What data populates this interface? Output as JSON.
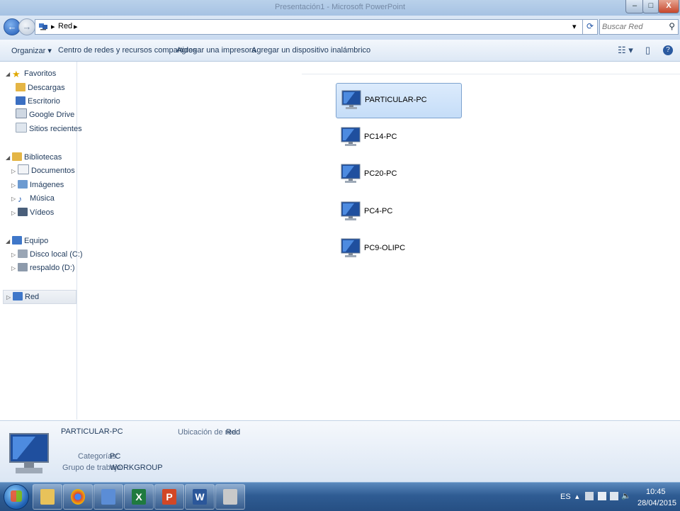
{
  "window": {
    "title": "Presentación1 - Microsoft PowerPoint",
    "buttons": {
      "minimize": "–",
      "maximize": "□",
      "close": "X"
    }
  },
  "address": {
    "breadcrumb": [
      "Red"
    ],
    "search_placeholder": "Buscar Red"
  },
  "toolbar": {
    "organize": "Organizar",
    "network_center": "Centro de redes y recursos compartidos",
    "add_printer": "Agregar una impresora",
    "add_wireless": "Agregar un dispositivo inalámbrico"
  },
  "nav": {
    "favorites": {
      "label": "Favoritos",
      "items": [
        "Descargas",
        "Escritorio",
        "Google Drive",
        "Sitios recientes"
      ]
    },
    "libraries": {
      "label": "Bibliotecas",
      "items": [
        "Documentos",
        "Imágenes",
        "Música",
        "Vídeos"
      ]
    },
    "computer": {
      "label": "Equipo",
      "items": [
        "Disco local (C:)",
        "respaldo (D:)"
      ]
    },
    "network": {
      "label": "Red"
    }
  },
  "network_items": [
    {
      "name": "PARTICULAR-PC",
      "selected": true
    },
    {
      "name": "PC14-PC",
      "selected": false
    },
    {
      "name": "PC20-PC",
      "selected": false
    },
    {
      "name": "PC4-PC",
      "selected": false
    },
    {
      "name": "PC9-OLIPC",
      "selected": false
    }
  ],
  "details": {
    "name": "PARTICULAR-PC",
    "location_label": "Ubicación de red:",
    "location_value": "Red",
    "categories_label": "Categorías:",
    "categories_value": "PC",
    "workgroup_label": "Grupo de trabajo:",
    "workgroup_value": "WORKGROUP"
  },
  "taskbar": {
    "apps": [
      {
        "icon": "folder-icon",
        "color": "#e8c25a"
      },
      {
        "icon": "chrome-icon",
        "color": "#db4437"
      },
      {
        "icon": "network-app-icon",
        "color": "#5b8dd6"
      },
      {
        "icon": "excel-icon",
        "color": "#1f7a3f",
        "glyph": "X"
      },
      {
        "icon": "powerpoint-icon",
        "color": "#d24726",
        "glyph": "P"
      },
      {
        "icon": "word-icon",
        "color": "#2b579a",
        "glyph": "W"
      },
      {
        "icon": "paint-icon",
        "color": "#c9c9c9"
      }
    ],
    "language": "ES",
    "time": "10:45",
    "date": "28/04/2015"
  },
  "colors": {
    "accent": "#1f58b5",
    "selection": "#c5ddf8"
  }
}
